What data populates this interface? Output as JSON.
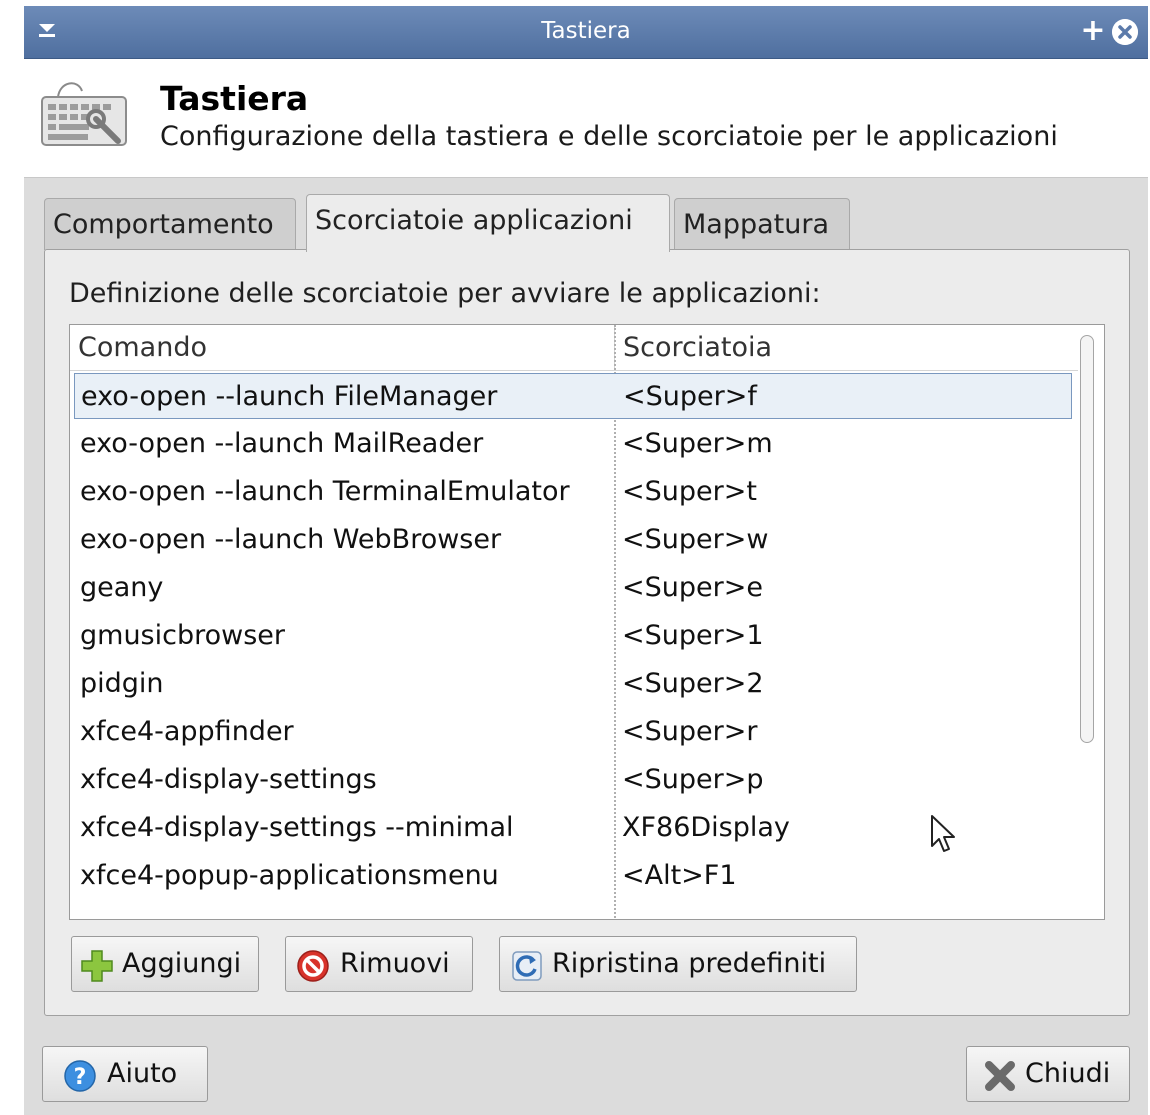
{
  "window": {
    "title": "Tastiera"
  },
  "header": {
    "title": "Tastiera",
    "subtitle": "Configurazione della tastiera e delle scorciatoie per le applicazioni"
  },
  "tabs": [
    {
      "label": "Comportamento",
      "active": false
    },
    {
      "label": "Scorciatoie applicazioni",
      "active": true
    },
    {
      "label": "Mappatura",
      "active": false
    }
  ],
  "shortcuts": {
    "section_label": "Definizione delle scorciatoie per avviare le applicazioni:",
    "columns": [
      "Comando",
      "Scorciatoia"
    ],
    "rows": [
      {
        "command": "exo-open --launch FileManager",
        "shortcut": "<Super>f",
        "selected": true
      },
      {
        "command": "exo-open --launch MailReader",
        "shortcut": "<Super>m"
      },
      {
        "command": "exo-open --launch TerminalEmulator",
        "shortcut": "<Super>t"
      },
      {
        "command": "exo-open --launch WebBrowser",
        "shortcut": "<Super>w"
      },
      {
        "command": "geany",
        "shortcut": "<Super>e"
      },
      {
        "command": "gmusicbrowser",
        "shortcut": "<Super>1"
      },
      {
        "command": "pidgin",
        "shortcut": "<Super>2"
      },
      {
        "command": "xfce4-appfinder",
        "shortcut": "<Super>r"
      },
      {
        "command": "xfce4-display-settings",
        "shortcut": "<Super>p"
      },
      {
        "command": "xfce4-display-settings --minimal",
        "shortcut": "XF86Display"
      },
      {
        "command": "xfce4-popup-applicationsmenu",
        "shortcut": "<Alt>F1"
      }
    ],
    "buttons": {
      "add": "Aggiungi",
      "remove": "Rimuovi",
      "reset": "Ripristina predefiniti"
    }
  },
  "footer": {
    "help": "Aiuto",
    "close": "Chiudi"
  },
  "icons": {
    "menu": "window-menu-icon",
    "maximize": "plus-icon",
    "close": "close-icon",
    "app": "keyboard-icon",
    "add": "plus-icon",
    "remove": "stop-icon",
    "reset": "reload-icon",
    "help": "help-icon",
    "close_btn": "x-icon"
  },
  "colors": {
    "titlebar": "#5b7aaa",
    "selection_border": "#7a98bf",
    "selection_bg": "#e9f0f7"
  }
}
